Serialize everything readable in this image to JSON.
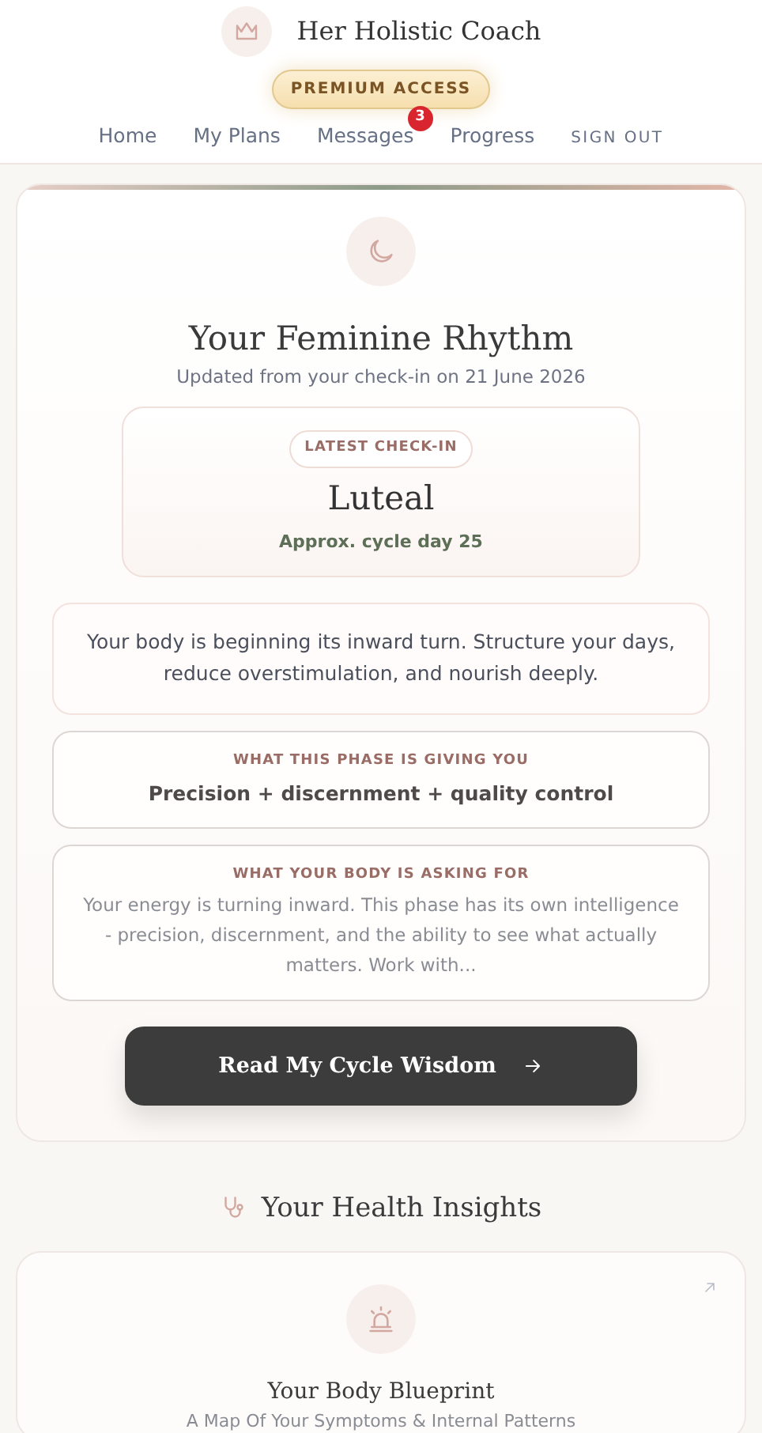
{
  "brand": {
    "name": "Her Holistic Coach"
  },
  "premium_badge": "PREMIUM ACCESS",
  "nav": [
    {
      "label": "Home",
      "kind": "link"
    },
    {
      "label": "My Plans",
      "kind": "link"
    },
    {
      "label": "Messages",
      "kind": "link",
      "badge": "3"
    },
    {
      "label": "Progress",
      "kind": "link"
    },
    {
      "label": "SIGN OUT",
      "kind": "signout"
    }
  ],
  "rhythm": {
    "title": "Your Feminine Rhythm",
    "subtitle": "Updated from your check-in on 21 June 2026",
    "checkin": {
      "tag": "LATEST CHECK-IN",
      "phase": "Luteal",
      "day": "Approx. cycle day 25"
    },
    "message": "Your body is beginning its inward turn. Structure your days, reduce overstimulation, and nourish deeply.",
    "panels": [
      {
        "label": "WHAT THIS PHASE IS GIVING YOU",
        "text": "Precision + discernment + quality control",
        "kind": "highlight"
      },
      {
        "label": "WHAT YOUR BODY IS ASKING FOR",
        "text": "Your energy is turning inward. This phase has its own intelligence - precision, discernment, and the ability to see what actually matters. Work with...",
        "kind": "body"
      }
    ],
    "button": "Read My Cycle Wisdom"
  },
  "insights": {
    "title": "Your Health Insights",
    "cards": [
      {
        "title": "Your Body Blueprint",
        "subtitle": "A Map Of Your Symptoms & Internal Patterns"
      }
    ]
  }
}
